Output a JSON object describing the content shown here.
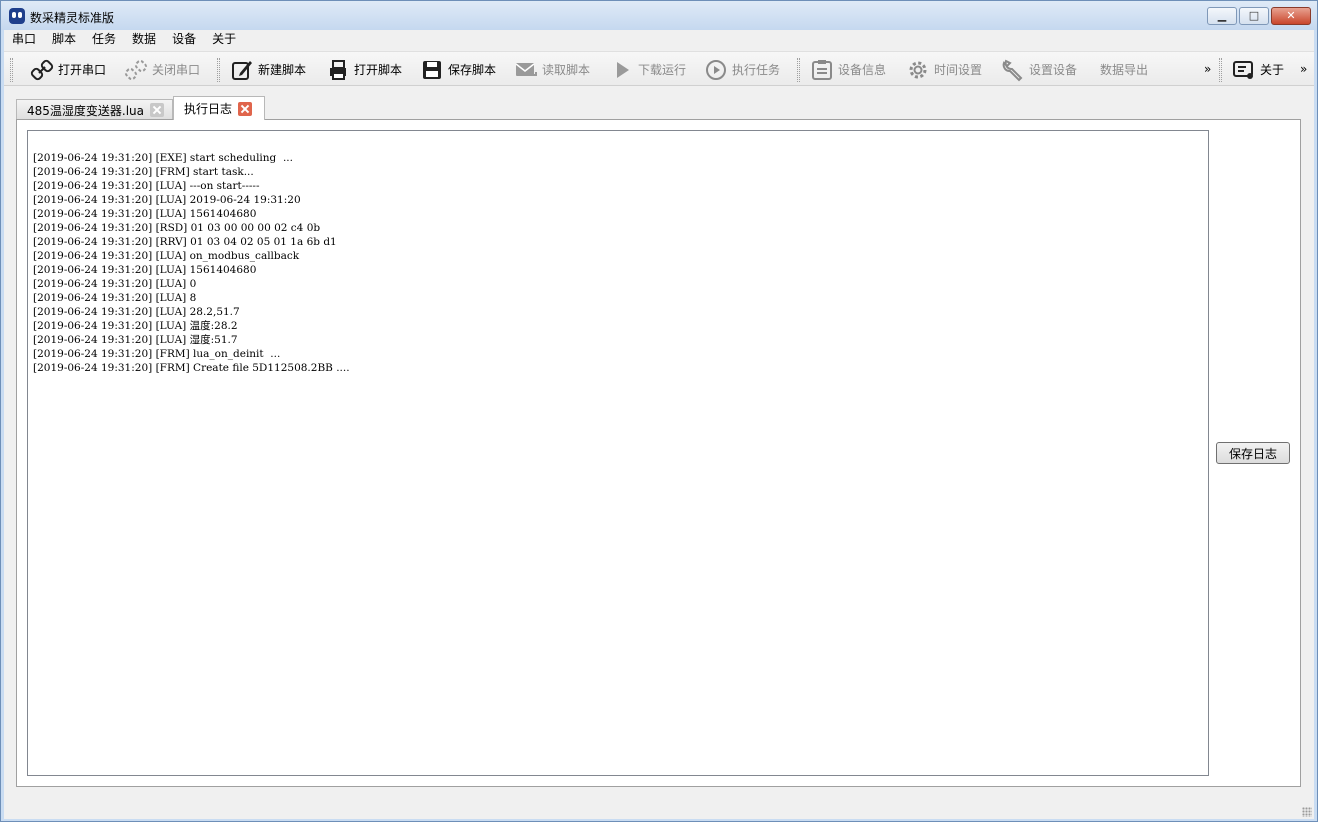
{
  "window": {
    "title": "数采精灵标准版"
  },
  "menu": [
    "串口",
    "脚本",
    "任务",
    "数据",
    "设备",
    "关于"
  ],
  "toolbar": {
    "open_port": "打开串口",
    "close_port": "关闭串口",
    "new_script": "新建脚本",
    "open_script": "打开脚本",
    "save_script": "保存脚本",
    "read_script": "读取脚本",
    "download_run": "下载运行",
    "execute_task": "执行任务",
    "device_info": "设备信息",
    "time_settings": "时间设置",
    "set_device": "设置设备",
    "data_export": "数据导出",
    "overflow": "»",
    "about": "关于",
    "overflow2": "»"
  },
  "tabs": [
    {
      "label": "485温湿度变送器.lua",
      "active": false
    },
    {
      "label": "执行日志",
      "active": true
    }
  ],
  "log": [
    "[2019-06-24 19:31:20] [EXE] start scheduling  ...",
    "[2019-06-24 19:31:20] [FRM] start task...",
    "[2019-06-24 19:31:20] [LUA] ---on start-----",
    "[2019-06-24 19:31:20] [LUA] 2019-06-24 19:31:20",
    "[2019-06-24 19:31:20] [LUA] 1561404680",
    "[2019-06-24 19:31:20] [RSD] 01 03 00 00 00 02 c4 0b",
    "[2019-06-24 19:31:20] [RRV] 01 03 04 02 05 01 1a 6b d1",
    "[2019-06-24 19:31:20] [LUA] on_modbus_callback",
    "[2019-06-24 19:31:20] [LUA] 1561404680",
    "[2019-06-24 19:31:20] [LUA] 0",
    "[2019-06-24 19:31:20] [LUA] 8",
    "[2019-06-24 19:31:20] [LUA] 28.2,51.7",
    "[2019-06-24 19:31:20] [LUA] 温度:28.2",
    "[2019-06-24 19:31:20] [LUA] 湿度:51.7",
    "[2019-06-24 19:31:20] [FRM] lua_on_deinit  ...",
    "[2019-06-24 19:31:20] [FRM] Create file 5D112508.2BB ...."
  ],
  "save_log_label": "保存日志",
  "window_buttons": {
    "minimize": "▁",
    "maximize": "□",
    "close": "✕"
  }
}
